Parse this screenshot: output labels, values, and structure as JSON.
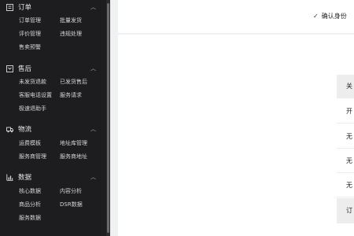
{
  "sidebar": {
    "sections": [
      {
        "title": "订单",
        "icon": "order-icon",
        "items": [
          "订单管理",
          "批量发货",
          "评价管理",
          "违规处理",
          "售卖预警"
        ]
      },
      {
        "title": "售后",
        "icon": "aftersale-icon",
        "items": [
          "未发货退款",
          "已发货售后",
          "客服电话设置",
          "服务请求",
          "极速退助手"
        ]
      },
      {
        "title": "物流",
        "icon": "logistics-icon",
        "items": [
          "运费模板",
          "地址库管理",
          "服务商管理",
          "服务商地址"
        ]
      },
      {
        "title": "数据",
        "icon": "data-icon",
        "items": [
          "核心数据",
          "内容分析",
          "商品分析",
          "DSR数据",
          "服务数据"
        ]
      }
    ]
  },
  "header": {
    "confirm_label": "确认身份"
  },
  "table": {
    "status_cells": [
      "关",
      "开",
      "无",
      "无",
      "无",
      "订"
    ]
  }
}
